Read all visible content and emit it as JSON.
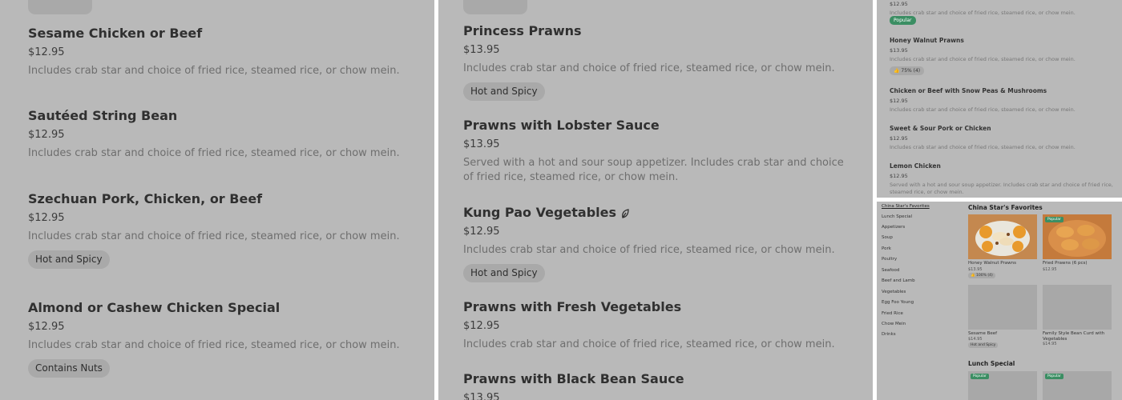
{
  "panel1": {
    "items": [
      {
        "name": "Sesame Chicken or Beef",
        "price": "$12.95",
        "desc": "Includes crab star and choice of fried rice, steamed rice, or chow mein."
      },
      {
        "name": "Sautéed String Bean",
        "price": "$12.95",
        "desc": "Includes crab star and choice of fried rice, steamed rice, or chow mein."
      },
      {
        "name": "Szechuan Pork, Chicken, or Beef",
        "price": "$12.95",
        "desc": "Includes crab star and choice of fried rice, steamed rice, or chow mein.",
        "tag": "Hot and Spicy"
      },
      {
        "name": "Almond or Cashew Chicken Special",
        "price": "$12.95",
        "desc": "Includes crab star and choice of fried rice, steamed rice, or chow mein.",
        "tag": "Contains Nuts"
      }
    ]
  },
  "panel2": {
    "items": [
      {
        "name": "Princess Prawns",
        "price": "$13.95",
        "desc": "Includes crab star and choice of fried rice, steamed rice, or chow mein.",
        "tag": "Hot and Spicy"
      },
      {
        "name": "Prawns with Lobster Sauce",
        "price": "$13.95",
        "desc": "Served with a hot and sour soup appetizer. Includes crab star and choice of fried rice, steamed rice, or chow mein."
      },
      {
        "name": "Kung Pao Vegetables",
        "price": "$12.95",
        "desc": "Includes crab star and choice of fried rice, steamed rice, or chow mein.",
        "tag": "Hot and Spicy",
        "icon": "leaf-icon"
      },
      {
        "name": "Prawns with Fresh Vegetables",
        "price": "$12.95",
        "desc": "Includes crab star and choice of fried rice, steamed rice, or chow mein."
      },
      {
        "name": "Prawns with Black Bean Sauce",
        "price": "$13.95"
      }
    ]
  },
  "panel3": {
    "top": {
      "price": "$12.95",
      "desc": "Includes crab star and choice of fried rice, steamed rice, or chow mein.",
      "badge": "Popular"
    },
    "items": [
      {
        "name": "Honey Walnut Prawns",
        "price": "$13.95",
        "desc": "Includes crab star and choice of fried rice, steamed rice, or chow mein.",
        "rating": "75% (4)"
      },
      {
        "name": "Chicken or Beef with Snow Peas & Mushrooms",
        "price": "$12.95",
        "desc": "Includes crab star and choice of fried rice, steamed rice, or chow mein."
      },
      {
        "name": "Sweet & Sour Pork or Chicken",
        "price": "$12.95",
        "desc": "Includes crab star and choice of fried rice, steamed rice, or chow mein."
      },
      {
        "name": "Lemon Chicken",
        "price": "$12.95",
        "desc": "Served with a hot and sour soup appetizer. Includes crab star and choice of fried rice, steamed rice, or chow mein."
      }
    ]
  },
  "panel4": {
    "nav": [
      "China Star's Favorites",
      "Lunch Special",
      "Appetizers",
      "Soup",
      "Pork",
      "Poultry",
      "Seafood",
      "Beef and Lamb",
      "Vegetables",
      "Egg Foo Young",
      "Fried Rice",
      "Chow Mein",
      "Drinks"
    ],
    "section1": "China Star's Favorites",
    "section2": "Lunch Special",
    "cards": [
      {
        "name": "Honey Walnut Prawns",
        "price": "$13.95",
        "rating": "100% (4)"
      },
      {
        "name": "Fried Prawns (6 pcs)",
        "price": "$12.95",
        "badge": "Popular"
      },
      {
        "name": "Sesame Beef",
        "price": "$14.95",
        "tag": "Hot and Spicy"
      },
      {
        "name": "Family Style Bean Curd with Vegetables",
        "price": "$14.95"
      }
    ],
    "popular_label": "Popular"
  },
  "colors": {
    "panel_bg": "#b9b9b9",
    "popular_badge": "#3b8e63",
    "chip_bg": "#a9a9a9"
  }
}
